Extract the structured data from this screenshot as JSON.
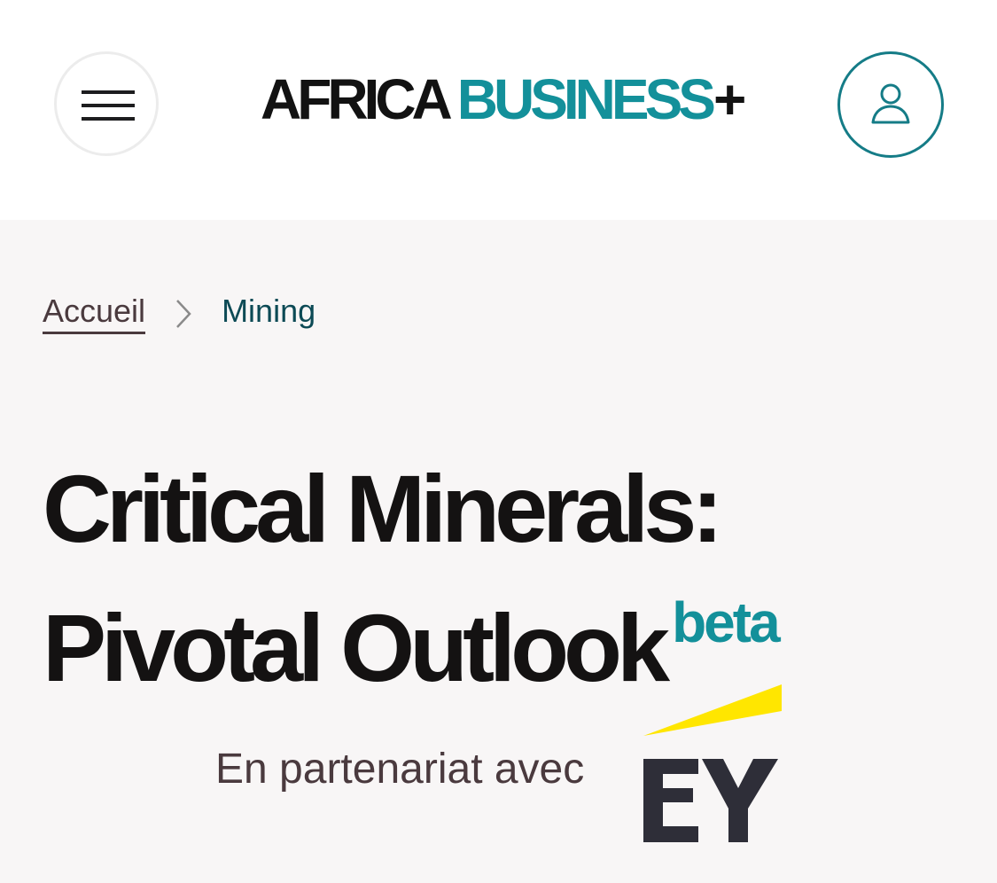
{
  "header": {
    "logo": {
      "part1": "AFRICA",
      "part2": "BUSINESS",
      "part3": "+"
    },
    "menu_icon": "hamburger-icon",
    "account_icon": "user-icon"
  },
  "breadcrumb": {
    "home": "Accueil",
    "separator_icon": "chevron-right-icon",
    "current": "Mining"
  },
  "page": {
    "title": "Critical Minerals: Pivotal Outlook",
    "badge": "beta",
    "partner_text": "En partenariat avec",
    "partner_logo": "EY"
  },
  "colors": {
    "brand_teal": "#13909a",
    "account_border": "#157c87",
    "ey_yellow": "#ffe600",
    "ey_dark": "#2e2e38",
    "page_bg": "#f8f6f6"
  }
}
